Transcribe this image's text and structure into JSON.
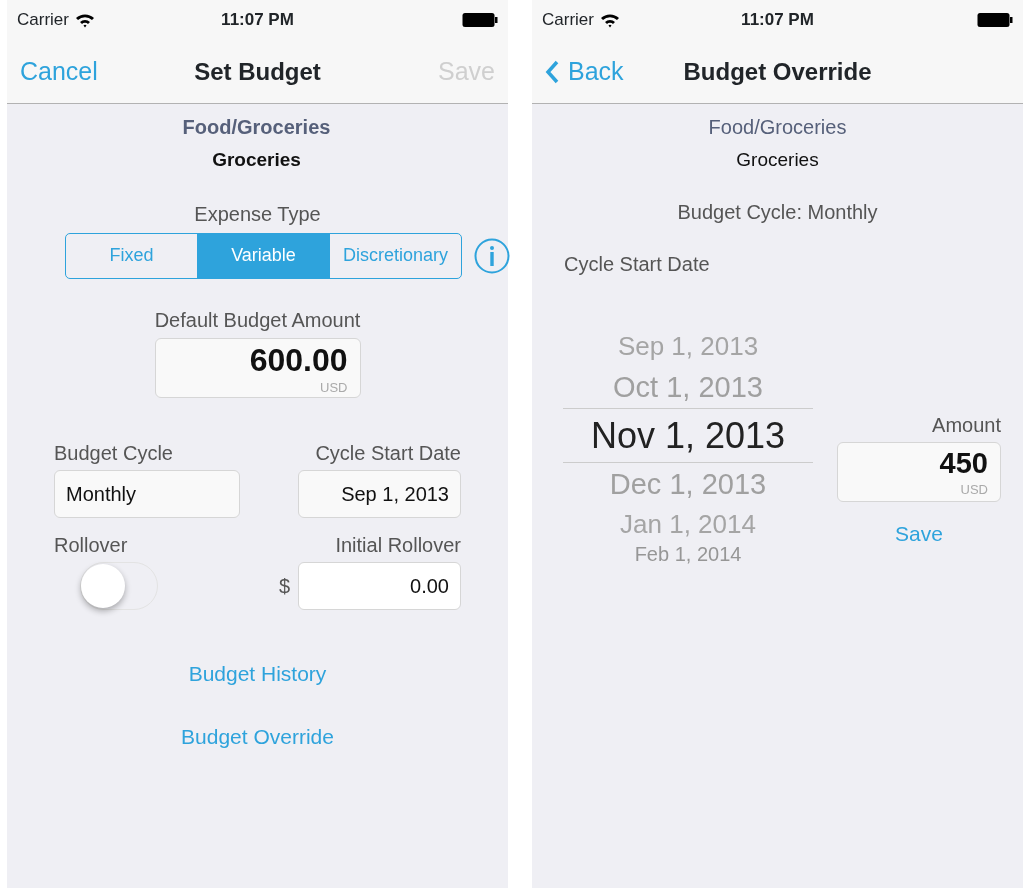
{
  "set_budget": {
    "status_bar": {
      "carrier": "Carrier",
      "time": "11:07 PM"
    },
    "nav": {
      "left": "Cancel",
      "title": "Set Budget",
      "right": {
        "label": "Save",
        "disabled": true
      }
    },
    "category": "Food/Groceries",
    "subcategory": "Groceries",
    "expense_type": {
      "label": "Expense Type",
      "options": [
        {
          "label": "Fixed",
          "selected": false
        },
        {
          "label": "Variable",
          "selected": true
        },
        {
          "label": "Discretionary",
          "selected": false
        }
      ]
    },
    "default_amount": {
      "label": "Default Budget Amount",
      "value": "600.00",
      "currency": "USD"
    },
    "budget_cycle": {
      "label": "Budget Cycle",
      "value": "Monthly"
    },
    "cycle_start": {
      "label": "Cycle Start Date",
      "value": "Sep 1, 2013"
    },
    "rollover": {
      "label": "Rollover",
      "on": false
    },
    "initial_rollover": {
      "label": "Initial Rollover",
      "prefix": "$",
      "value": "0.00"
    },
    "links": [
      "Budget History",
      "Budget Override"
    ]
  },
  "budget_override": {
    "status_bar": {
      "carrier": "Carrier",
      "time": "11:07 PM"
    },
    "nav": {
      "back": "Back",
      "title": "Budget Override"
    },
    "category": "Food/Groceries",
    "subcategory": "Groceries",
    "cycle_text": "Budget Cycle: Monthly",
    "start_label": "Cycle Start Date",
    "picker": [
      {
        "label": "Sep 1, 2013",
        "selected": false
      },
      {
        "label": "Oct 1, 2013",
        "selected": false
      },
      {
        "label": "Nov 1, 2013",
        "selected": true
      },
      {
        "label": "Dec 1, 2013",
        "selected": false
      },
      {
        "label": "Jan 1, 2014",
        "selected": false
      },
      {
        "label": "Feb 1, 2014",
        "selected": false
      }
    ],
    "amount": {
      "label": "Amount",
      "value": "450",
      "currency": "USD"
    },
    "save": "Save"
  }
}
